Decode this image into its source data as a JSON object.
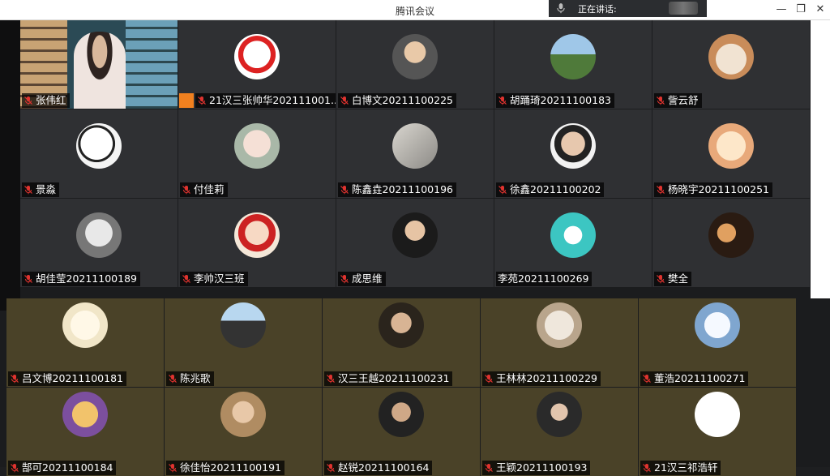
{
  "window": {
    "title": "腾讯会议",
    "speaking_label": "正在讲话:"
  },
  "participants": [
    {
      "name": "张伟红",
      "mic": true
    },
    {
      "name": "21汉三张帅华202111001...",
      "mic": true,
      "host": true
    },
    {
      "name": "白博文20211100225",
      "mic": true
    },
    {
      "name": "胡踊琦20211100183",
      "mic": true
    },
    {
      "name": "訾云舒",
      "mic": true
    },
    {
      "name": "景淼",
      "mic": true
    },
    {
      "name": "付佳莉",
      "mic": true
    },
    {
      "name": "陈鑫垚20211100196",
      "mic": true
    },
    {
      "name": "徐鑫20211100202",
      "mic": true
    },
    {
      "name": "杨晓宇20211100251",
      "mic": true
    },
    {
      "name": "胡佳莹20211100189",
      "mic": true
    },
    {
      "name": "李帅汉三班",
      "mic": true
    },
    {
      "name": "成思维",
      "mic": true
    },
    {
      "name": "李苑20211100269",
      "mic": false
    },
    {
      "name": "樊全",
      "mic": true
    },
    {
      "name": "吕文博20211100181",
      "mic": true
    },
    {
      "name": "陈兆歌",
      "mic": true
    },
    {
      "name": "汉三王越20211100231",
      "mic": true
    },
    {
      "name": "王林林20211100229",
      "mic": true
    },
    {
      "name": "董浩20211100271",
      "mic": true
    },
    {
      "name": "郜可20211100184",
      "mic": true
    },
    {
      "name": "徐佳怡20211100191",
      "mic": true
    },
    {
      "name": "赵锐20211100164",
      "mic": true
    },
    {
      "name": "王颖20211100193",
      "mic": true
    },
    {
      "name": "21汉三祁浩轩",
      "mic": true
    }
  ],
  "colors": {
    "tile": "#2f3033",
    "tile_overlay": "#4a4228",
    "mic": "#e0332f",
    "host": "#f0801f"
  }
}
